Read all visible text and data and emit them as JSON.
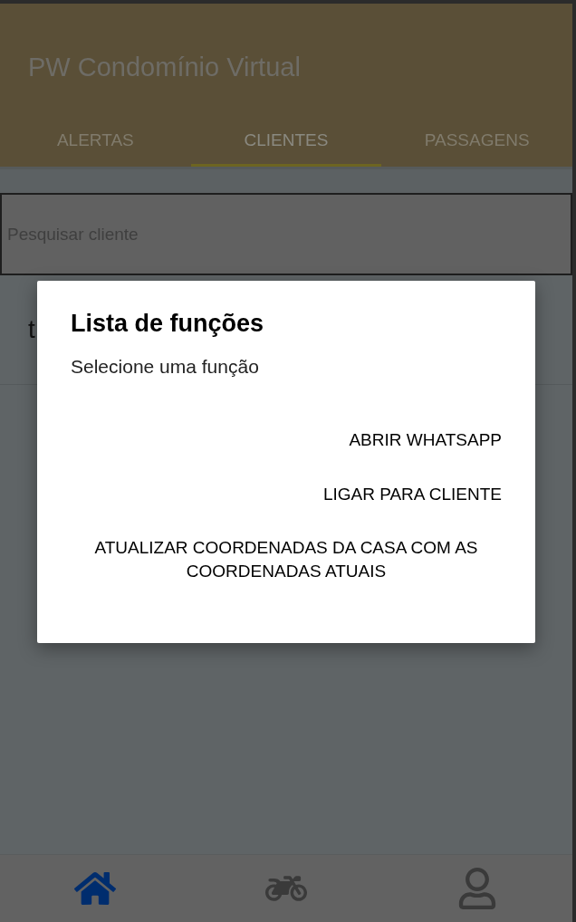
{
  "app_bar": {
    "title": "PW Condomínio Virtual"
  },
  "tabs": [
    {
      "label": "ALERTAS",
      "selected": false
    },
    {
      "label": "CLIENTES",
      "selected": true
    },
    {
      "label": "PASSAGENS",
      "selected": false
    }
  ],
  "search": {
    "placeholder": "Pesquisar cliente"
  },
  "clients": [
    {
      "name": "t"
    }
  ],
  "dialog": {
    "title": "Lista de funções",
    "message": "Selecione uma função",
    "actions": [
      {
        "label": "ABRIR WHATSAPP"
      },
      {
        "label": "LIGAR PARA CLIENTE"
      },
      {
        "label": "ATUALIZAR COORDENADAS DA CASA COM AS COORDENADAS ATUAIS"
      }
    ]
  },
  "bottom_nav": [
    {
      "selected": true
    },
    {
      "selected": false
    },
    {
      "selected": false
    }
  ]
}
